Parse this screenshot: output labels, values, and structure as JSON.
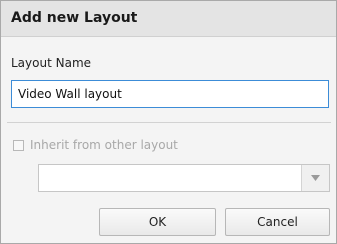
{
  "dialog": {
    "title": "Add new Layout",
    "layout_name_label": "Layout Name",
    "layout_name_value": "Video Wall layout",
    "inherit_label": "Inherit from other layout",
    "inherit_checked": false,
    "inherit_select_value": "",
    "ok_label": "OK",
    "cancel_label": "Cancel"
  },
  "icons": {
    "dropdown": "chevron-down-icon"
  },
  "colors": {
    "input_focus_border": "#3c8cd7",
    "disabled_text": "#a8a8a8"
  }
}
